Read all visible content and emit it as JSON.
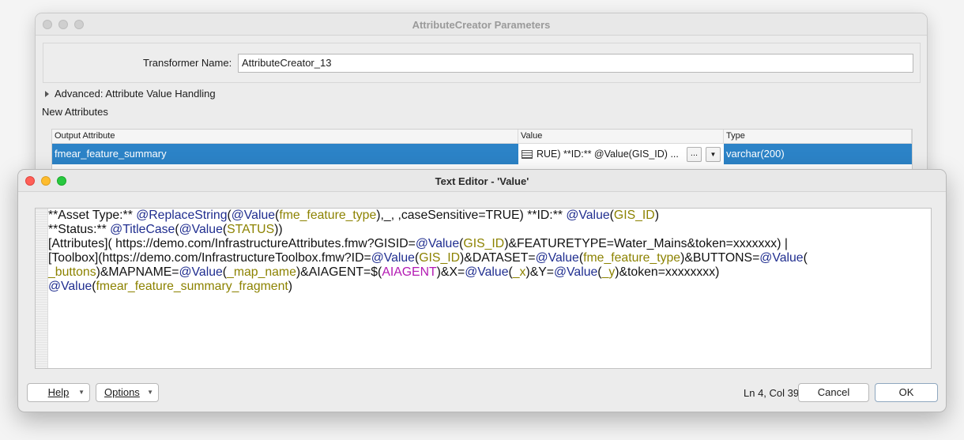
{
  "param_window": {
    "title": "AttributeCreator Parameters",
    "transformer_name_label": "Transformer Name:",
    "transformer_name_value": "AttributeCreator_13",
    "advanced_label": "Advanced: Attribute Value Handling",
    "new_attributes_label": "New Attributes",
    "table": {
      "headers": [
        "Output Attribute",
        "Value",
        "Type"
      ],
      "rows": [
        {
          "output": "fmear_feature_summary",
          "value": "RUE) **ID:** @Value(GIS_ID) ...",
          "type": "varchar(200)"
        }
      ]
    },
    "ellipsis": "...",
    "dropdown_arrow": "▼"
  },
  "editor": {
    "title": "Text Editor - 'Value'",
    "code_lines": [
      [
        [
          "t",
          "**Asset Type:** "
        ],
        [
          "f",
          "@ReplaceString"
        ],
        [
          "t",
          "("
        ],
        [
          "f",
          "@Value"
        ],
        [
          "t",
          "("
        ],
        [
          "a",
          "fme_feature_type"
        ],
        [
          "t",
          "),_, ,caseSensitive=TRUE) **ID:** "
        ],
        [
          "f",
          "@Value"
        ],
        [
          "t",
          "("
        ],
        [
          "a",
          "GIS_ID"
        ],
        [
          "t",
          ")"
        ]
      ],
      [
        [
          "t",
          "**Status:** "
        ],
        [
          "f",
          "@TitleCase"
        ],
        [
          "t",
          "("
        ],
        [
          "f",
          "@Value"
        ],
        [
          "t",
          "("
        ],
        [
          "a",
          "STATUS"
        ],
        [
          "t",
          "))"
        ]
      ],
      [
        [
          "t",
          "[Attributes]( https://demo.com/InfrastructureAttributes.fmw?GISID="
        ],
        [
          "f",
          "@Value"
        ],
        [
          "t",
          "("
        ],
        [
          "a",
          "GIS_ID"
        ],
        [
          "t",
          ")&FEATURETYPE=Water_Mains&token=xxxxxxx) |"
        ]
      ],
      [
        [
          "t",
          "[Toolbox](https://demo.com/InfrastructureToolbox.fmw?ID="
        ],
        [
          "f",
          "@Value"
        ],
        [
          "t",
          "("
        ],
        [
          "a",
          "GIS_ID"
        ],
        [
          "t",
          ")&DATASET="
        ],
        [
          "f",
          "@Value"
        ],
        [
          "t",
          "("
        ],
        [
          "a",
          "fme_feature_type"
        ],
        [
          "t",
          ")&BUTTONS="
        ],
        [
          "f",
          "@Value"
        ],
        [
          "t",
          "("
        ]
      ],
      [
        [
          "a",
          "_buttons"
        ],
        [
          "t",
          ")&MAPNAME="
        ],
        [
          "f",
          "@Value"
        ],
        [
          "t",
          "("
        ],
        [
          "a",
          "_map_name"
        ],
        [
          "t",
          ")&AIAGENT=$("
        ],
        [
          "p",
          "AIAGENT"
        ],
        [
          "t",
          ")&X="
        ],
        [
          "f",
          "@Value"
        ],
        [
          "t",
          "("
        ],
        [
          "a",
          "_x"
        ],
        [
          "t",
          ")&Y="
        ],
        [
          "f",
          "@Value"
        ],
        [
          "t",
          "("
        ],
        [
          "a",
          "_y"
        ],
        [
          "t",
          ")&token=xxxxxxxx)"
        ]
      ],
      [
        [
          "f",
          "@Value"
        ],
        [
          "t",
          "("
        ],
        [
          "a",
          "fmear_feature_summary_fragment"
        ],
        [
          "t",
          ")"
        ]
      ]
    ],
    "help_label": "Help",
    "options_label": "Options",
    "cursor_position": "Ln 4, Col 39",
    "cancel_label": "Cancel",
    "ok_label": "OK",
    "dropdown_arrow": "▼"
  },
  "colors": {
    "selection": "#2c83c7",
    "function": "#1f2d8f",
    "attribute": "#8c8200",
    "parameter": "#b31ab3"
  }
}
